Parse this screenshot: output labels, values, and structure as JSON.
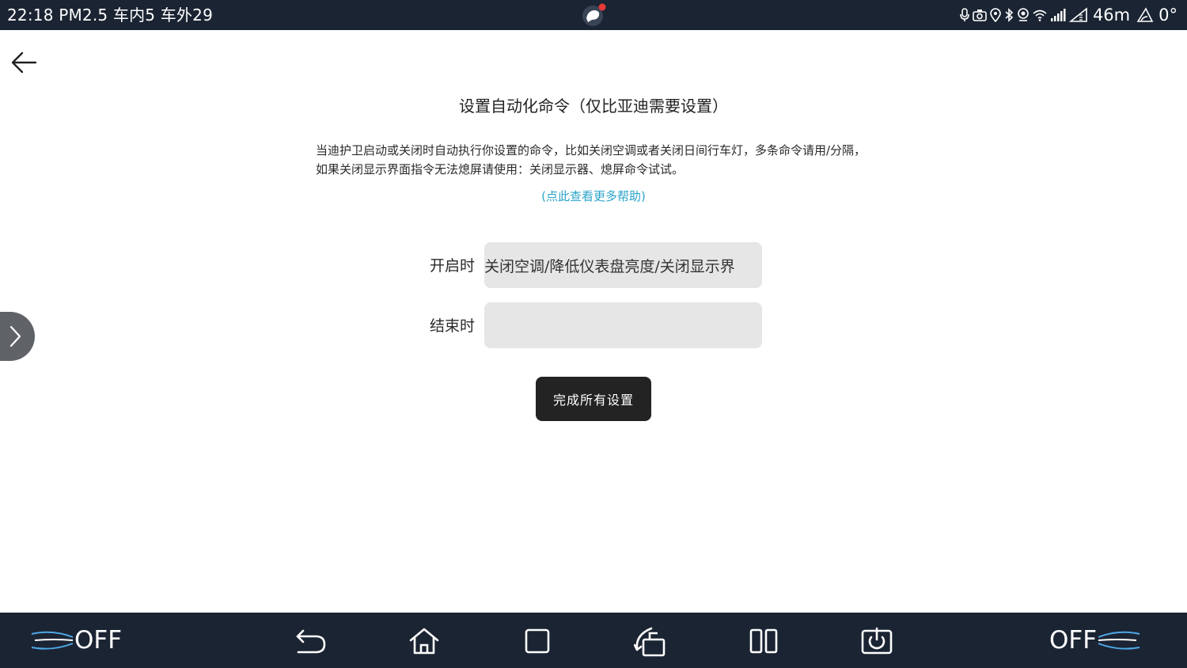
{
  "status_bar": {
    "left_text": "22:18  PM2.5 车内5 车外29",
    "altitude": "46m",
    "angle": "0°"
  },
  "page": {
    "title": "设置自动化命令（仅比亚迪需要设置）",
    "description": "当迪护卫启动或关闭时自动执行你设置的命令，比如关闭空调或者关闭日间行车灯，多条命令请用/分隔，如果关闭显示界面指令无法熄屏请使用：关闭显示器、熄屏命令试试。",
    "help_link": "(点此查看更多帮助)",
    "fields": {
      "start": {
        "label": "开启时",
        "value": "关闭空调/降低仪表盘亮度/关闭显示界",
        "placeholder": ""
      },
      "end": {
        "label": "结束时",
        "value": "",
        "placeholder": ""
      }
    },
    "finish_button": "完成所有设置"
  },
  "bottom_bar": {
    "left_climate": "OFF",
    "right_climate": "OFF",
    "icons": [
      "back-icon",
      "home-icon",
      "recent-apps-icon",
      "rotate-screen-icon",
      "split-screen-icon",
      "power-icon"
    ]
  },
  "colors": {
    "bar_background": "#1b2433",
    "link": "#2aa5c9",
    "button_background": "#232323",
    "input_background": "#e7e6e6",
    "notification_dot": "#e53935"
  }
}
